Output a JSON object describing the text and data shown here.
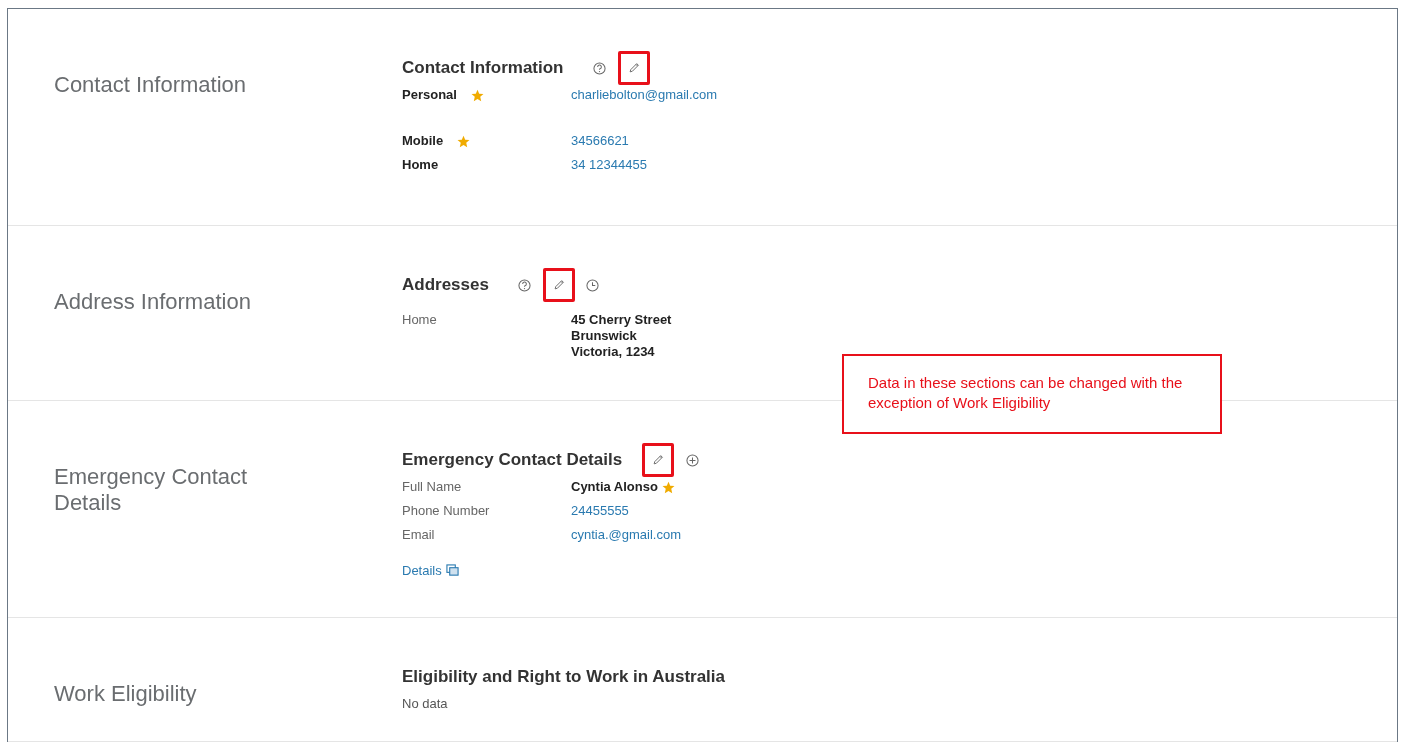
{
  "sections": [
    {
      "title": "Contact Information",
      "heading": "Contact Information",
      "icons": [
        {
          "kind": "help",
          "highlighted": false
        },
        {
          "kind": "edit",
          "highlighted": true
        }
      ],
      "rows": [
        {
          "label": "Personal",
          "strong": true,
          "primary": true,
          "kind": "link",
          "lines": [
            "charliebolton@gmail.com"
          ]
        },
        {
          "label": "Mobile",
          "strong": true,
          "primary": true,
          "kind": "link",
          "lines": [
            "34566621"
          ]
        },
        {
          "label": "Home",
          "strong": true,
          "kind": "link",
          "lines": [
            "34 12344455"
          ]
        }
      ]
    },
    {
      "title": "Address Information",
      "heading": "Addresses",
      "icons": [
        {
          "kind": "help",
          "highlighted": false
        },
        {
          "kind": "edit",
          "highlighted": true
        },
        {
          "kind": "history",
          "highlighted": false
        }
      ],
      "rows": [
        {
          "label": "Home",
          "strong": false,
          "kind": "text",
          "lines": [
            "45 Cherry Street",
            "Brunswick",
            "Victoria, 1234"
          ]
        }
      ]
    },
    {
      "title": "Emergency Contact Details",
      "heading": "Emergency Contact Details",
      "icons": [
        {
          "kind": "edit",
          "highlighted": true
        },
        {
          "kind": "add",
          "highlighted": false
        }
      ],
      "rows": [
        {
          "label": "Full Name",
          "strong": false,
          "primary": true,
          "kind": "text",
          "lines": [
            "Cyntia Alonso"
          ]
        },
        {
          "label": "Phone Number",
          "strong": false,
          "kind": "link",
          "lines": [
            "24455555"
          ]
        },
        {
          "label": "Email",
          "strong": false,
          "kind": "link",
          "lines": [
            "cyntia.@gmail.com"
          ]
        }
      ],
      "link": "Details"
    },
    {
      "title": "Work Eligibility",
      "heading": "Eligibility and Right to Work in Australia",
      "empty": "No data"
    }
  ],
  "callout": "Data in these sections can be changed with the exception of Work Eligibility"
}
